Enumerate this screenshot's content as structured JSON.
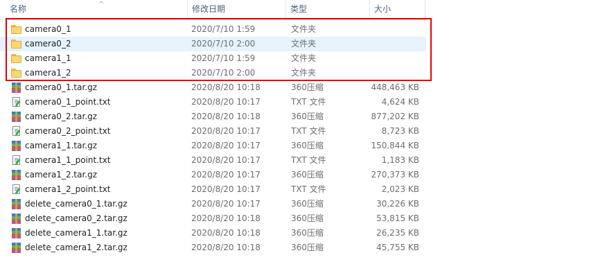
{
  "columns": {
    "name": "名称",
    "date": "修改日期",
    "type": "类型",
    "size": "大小"
  },
  "sort_indicator": "^",
  "colors": {
    "highlight": "#e60000",
    "hover_row": "#e5f3ff",
    "header_text": "#4c607a"
  },
  "files": [
    {
      "name": "camera0_1",
      "date": "2020/7/10 1:59",
      "type": "文件夹",
      "size": "",
      "icon": "folder-icon"
    },
    {
      "name": "camera0_2",
      "date": "2020/7/10 2:00",
      "type": "文件夹",
      "size": "",
      "icon": "folder-icon"
    },
    {
      "name": "camera1_1",
      "date": "2020/7/10 1:59",
      "type": "文件夹",
      "size": "",
      "icon": "folder-icon"
    },
    {
      "name": "camera1_2",
      "date": "2020/7/10 2:00",
      "type": "文件夹",
      "size": "",
      "icon": "folder-icon"
    },
    {
      "name": "camera0_1.tar.gz",
      "date": "2020/8/20 10:18",
      "type": "360压缩",
      "size": "448,463 KB",
      "icon": "archive-icon"
    },
    {
      "name": "camera0_1_point.txt",
      "date": "2020/8/20 10:17",
      "type": "TXT 文件",
      "size": "4,624 KB",
      "icon": "text-file-icon"
    },
    {
      "name": "camera0_2.tar.gz",
      "date": "2020/8/20 10:18",
      "type": "360压缩",
      "size": "877,202 KB",
      "icon": "archive-icon"
    },
    {
      "name": "camera0_2_point.txt",
      "date": "2020/8/20 10:17",
      "type": "TXT 文件",
      "size": "8,723 KB",
      "icon": "text-file-icon"
    },
    {
      "name": "camera1_1.tar.gz",
      "date": "2020/8/20 10:17",
      "type": "360压缩",
      "size": "150,844 KB",
      "icon": "archive-icon"
    },
    {
      "name": "camera1_1_point.txt",
      "date": "2020/8/20 10:17",
      "type": "TXT 文件",
      "size": "1,183 KB",
      "icon": "text-file-icon"
    },
    {
      "name": "camera1_2.tar.gz",
      "date": "2020/8/20 10:17",
      "type": "360压缩",
      "size": "270,373 KB",
      "icon": "archive-icon"
    },
    {
      "name": "camera1_2_point.txt",
      "date": "2020/8/20 10:17",
      "type": "TXT 文件",
      "size": "2,023 KB",
      "icon": "text-file-icon"
    },
    {
      "name": "delete_camera0_1.tar.gz",
      "date": "2020/8/20 10:17",
      "type": "360压缩",
      "size": "30,226 KB",
      "icon": "archive-icon"
    },
    {
      "name": "delete_camera0_2.tar.gz",
      "date": "2020/8/20 10:18",
      "type": "360压缩",
      "size": "53,815 KB",
      "icon": "archive-icon"
    },
    {
      "name": "delete_camera1_1.tar.gz",
      "date": "2020/8/20 10:18",
      "type": "360压缩",
      "size": "26,235 KB",
      "icon": "archive-icon"
    },
    {
      "name": "delete_camera1_2.tar.gz",
      "date": "2020/8/20 10:18",
      "type": "360压缩",
      "size": "45,755 KB",
      "icon": "archive-icon"
    }
  ]
}
